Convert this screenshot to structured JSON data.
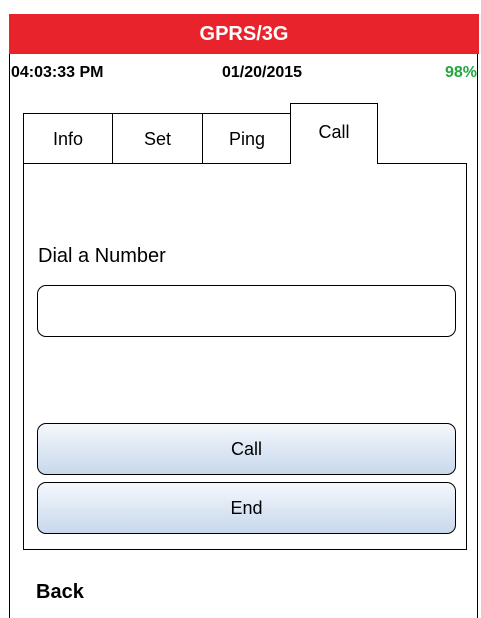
{
  "header": {
    "title": "GPRS/3G",
    "title_bg_color": "#e8232b"
  },
  "status": {
    "time": "04:03:33 PM",
    "date": "01/20/2015",
    "battery": "98%",
    "battery_color": "#21a83c"
  },
  "tabs": [
    {
      "label": "Info",
      "active": false
    },
    {
      "label": "Set",
      "active": false
    },
    {
      "label": "Ping",
      "active": false
    },
    {
      "label": "Call",
      "active": true
    }
  ],
  "call_panel": {
    "dial_label": "Dial a Number",
    "number_value": "",
    "call_button": "Call",
    "end_button": "End"
  },
  "footer": {
    "back_label": "Back"
  }
}
